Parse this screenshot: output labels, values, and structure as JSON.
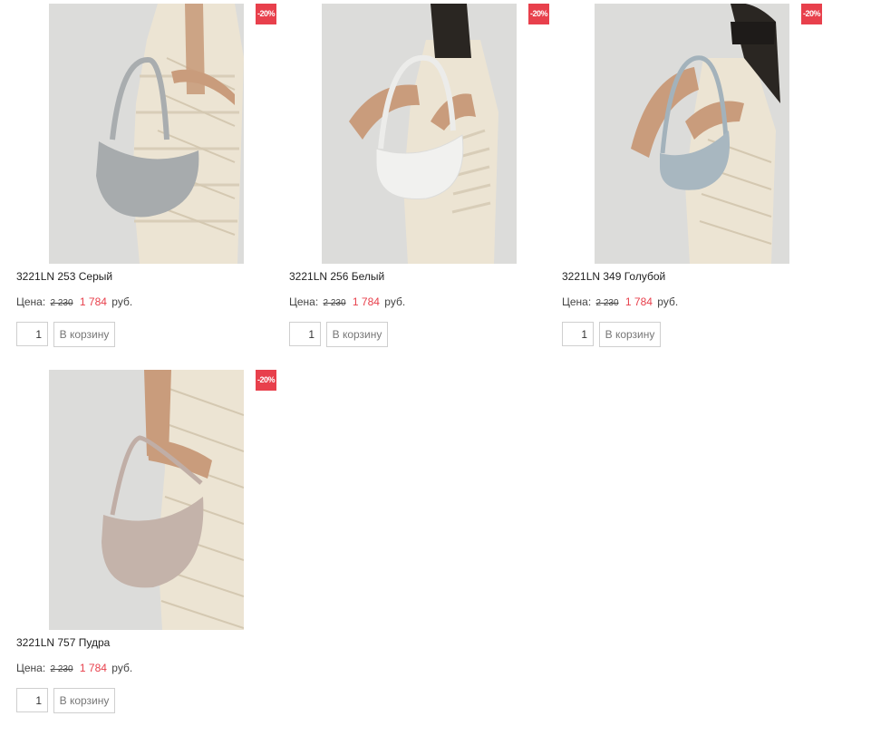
{
  "products": [
    {
      "title": "3221LN 253 Серый",
      "badge": "-20%",
      "price_label": "Цена:",
      "old_price": "2 230",
      "new_price": "1 784",
      "currency": "руб.",
      "qty": "1",
      "cart_label": "В корзину",
      "bag_color": "#a7abad"
    },
    {
      "title": "3221LN 256 Белый",
      "badge": "-20%",
      "price_label": "Цена:",
      "old_price": "2 230",
      "new_price": "1 784",
      "currency": "руб.",
      "qty": "1",
      "cart_label": "В корзину",
      "bag_color": "#f1f1ef"
    },
    {
      "title": "3221LN 349 Голубой",
      "badge": "-20%",
      "price_label": "Цена:",
      "old_price": "2 230",
      "new_price": "1 784",
      "currency": "руб.",
      "qty": "1",
      "cart_label": "В корзину",
      "bag_color": "#a8b7c0"
    },
    {
      "title": "3221LN 757 Пудра",
      "badge": "-20%",
      "price_label": "Цена:",
      "old_price": "2 230",
      "new_price": "1 784",
      "currency": "руб.",
      "qty": "1",
      "cart_label": "В корзину",
      "bag_color": "#c4b3aa"
    }
  ],
  "colors": {
    "accent_red": "#e8404c",
    "dress": "#ece4d3",
    "skin": "#c99c7c",
    "background_photo": "#d9d9d7"
  }
}
